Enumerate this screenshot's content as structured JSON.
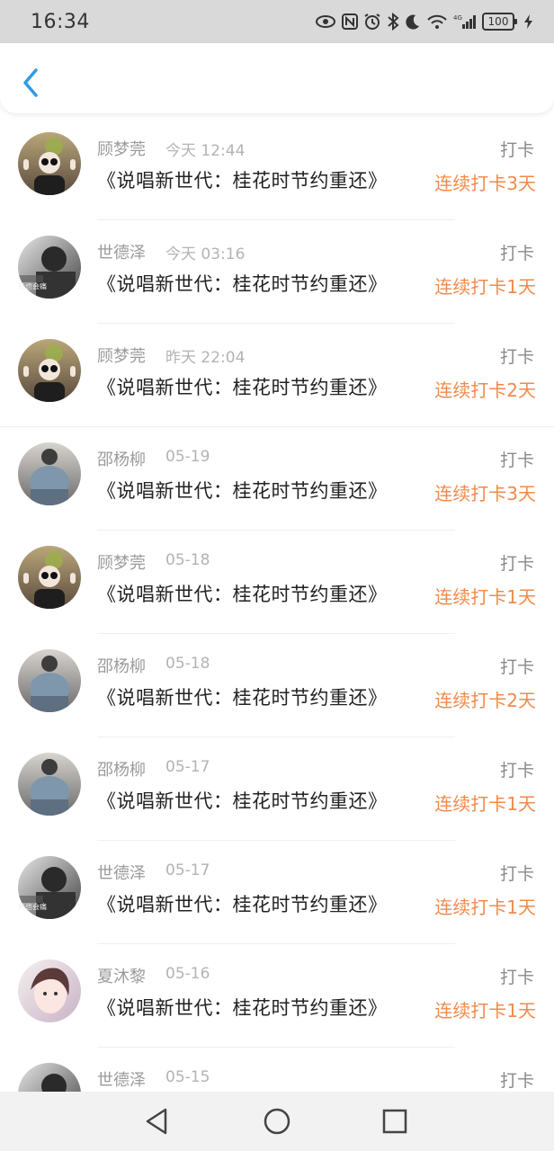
{
  "status_bar": {
    "time": "16:34",
    "battery": "100",
    "icons": [
      "eye-icon",
      "nfc-icon",
      "alarm-icon",
      "bluetooth-icon",
      "moon-icon",
      "wifi-icon",
      "signal-icon",
      "charging-icon"
    ],
    "network_label": "4G"
  },
  "header": {
    "back_icon": "chevron-left-icon",
    "accent": "#2f9be6"
  },
  "colors": {
    "streak": "#f08a4b",
    "name": "#9a9a9a",
    "title": "#222222"
  },
  "entries": [
    {
      "name": "顾梦莞",
      "date": "今天 12:44",
      "title": "《说唱新世代：桂花时节约重还》",
      "type": "打卡",
      "streak": "连续打卡3天",
      "avatar": "avatar-a"
    },
    {
      "name": "世德泽",
      "date": "今天 03:16",
      "title": "《说唱新世代：桂花时节约重还》",
      "type": "打卡",
      "streak": "连续打卡1天",
      "avatar": "avatar-b",
      "avatar_caption": "先也会痛"
    },
    {
      "name": "顾梦莞",
      "date": "昨天 22:04",
      "title": "《说唱新世代：桂花时节约重还》",
      "type": "打卡",
      "streak": "连续打卡2天",
      "avatar": "avatar-a"
    },
    {
      "name": "邵杨柳",
      "date": "05-19",
      "title": "《说唱新世代：桂花时节约重还》",
      "type": "打卡",
      "streak": "连续打卡3天",
      "avatar": "avatar-c"
    },
    {
      "name": "顾梦莞",
      "date": "05-18",
      "title": "《说唱新世代：桂花时节约重还》",
      "type": "打卡",
      "streak": "连续打卡1天",
      "avatar": "avatar-a"
    },
    {
      "name": "邵杨柳",
      "date": "05-18",
      "title": "《说唱新世代：桂花时节约重还》",
      "type": "打卡",
      "streak": "连续打卡2天",
      "avatar": "avatar-c"
    },
    {
      "name": "邵杨柳",
      "date": "05-17",
      "title": "《说唱新世代：桂花时节约重还》",
      "type": "打卡",
      "streak": "连续打卡1天",
      "avatar": "avatar-c"
    },
    {
      "name": "世德泽",
      "date": "05-17",
      "title": "《说唱新世代：桂花时节约重还》",
      "type": "打卡",
      "streak": "连续打卡1天",
      "avatar": "avatar-b",
      "avatar_caption": "先也会痛"
    },
    {
      "name": "夏沐黎",
      "date": "05-16",
      "title": "《说唱新世代：桂花时节约重还》",
      "type": "打卡",
      "streak": "连续打卡1天",
      "avatar": "avatar-d"
    },
    {
      "name": "世德泽",
      "date": "05-15",
      "title": "",
      "type": "打卡",
      "streak": "",
      "avatar": "avatar-b",
      "avatar_caption": ""
    }
  ],
  "nav_bar": {
    "back": "nav-back-icon",
    "home": "nav-home-icon",
    "recents": "nav-recents-icon"
  }
}
